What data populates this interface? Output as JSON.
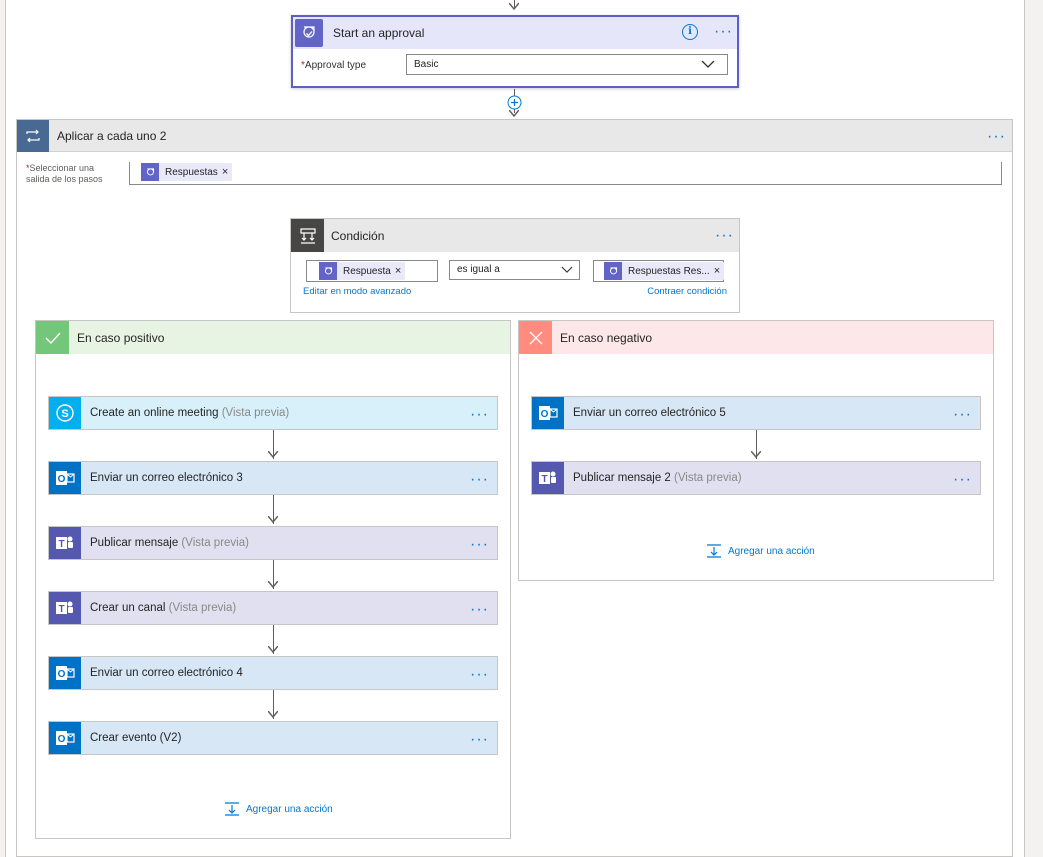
{
  "approval": {
    "title": "Start an approval",
    "field_label": "Approval type",
    "required_mark": "*",
    "field_value": "Basic"
  },
  "foreach": {
    "title": "Aplicar a cada uno 2",
    "select_label_line1": "Seleccionar una",
    "select_label_line2": "salida de los pasos",
    "required_mark": "*",
    "token": "Respuestas",
    "remove_glyph": "×"
  },
  "condition": {
    "title": "Condición",
    "left_token": "Respuesta",
    "operator": "es igual a",
    "right_token": "Respuestas Res...",
    "edit_advanced": "Editar en modo avanzado",
    "collapse": "Contraer condición",
    "remove_glyph": "×"
  },
  "branches": {
    "yes": {
      "title": "En caso positivo",
      "actions": [
        {
          "title": "Create an online meeting",
          "preview": "(Vista previa)",
          "icon": "skype-icon"
        },
        {
          "title": "Enviar un correo electrónico 3",
          "preview": "",
          "icon": "outlook-icon"
        },
        {
          "title": "Publicar mensaje",
          "preview": "(Vista previa)",
          "icon": "teams-icon"
        },
        {
          "title": "Crear un canal",
          "preview": "(Vista previa)",
          "icon": "teams-icon"
        },
        {
          "title": "Enviar un correo electrónico 4",
          "preview": "",
          "icon": "outlook-icon"
        },
        {
          "title": "Crear evento (V2)",
          "preview": "",
          "icon": "outlook-icon"
        }
      ],
      "add_action": "Agregar una acción"
    },
    "no": {
      "title": "En caso negativo",
      "actions": [
        {
          "title": "Enviar un correo electrónico 5",
          "preview": "",
          "icon": "outlook-icon"
        },
        {
          "title": "Publicar mensaje 2",
          "preview": "(Vista previa)",
          "icon": "teams-icon"
        }
      ],
      "add_action": "Agregar una acción"
    }
  },
  "colors": {
    "approval": "#6264c7",
    "foreach": "#486991",
    "condition": "#484644",
    "yes": "#74c67a",
    "no": "#ff8c7e",
    "skype": "#00aff0",
    "outlook": "#0072c6",
    "teams": "#5558af",
    "link": "#0078d4"
  }
}
